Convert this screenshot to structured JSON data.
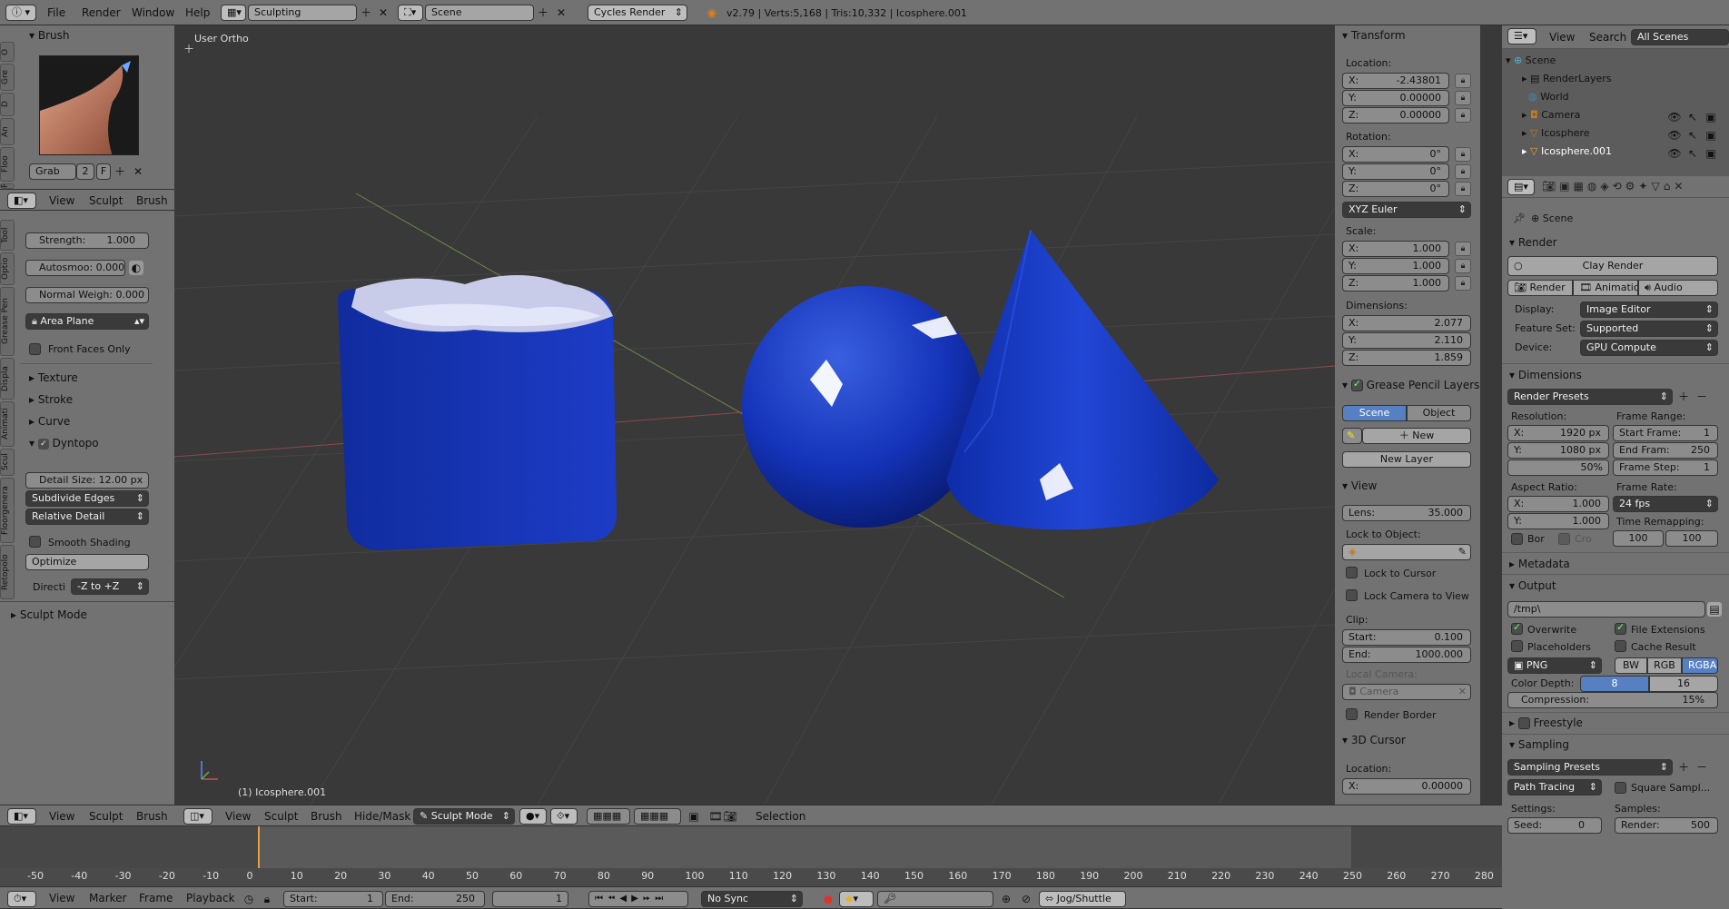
{
  "topbar": {
    "menu": [
      "File",
      "Render",
      "Window",
      "Help"
    ],
    "workspace": "Sculpting",
    "scene": "Scene",
    "engine": "Cycles Render",
    "stats": "v2.79 | Verts:5,168 | Tris:10,332 | Icosphere.001"
  },
  "tool_shelf": {
    "tabs": [
      "O",
      "Gre",
      "D",
      "An",
      "Floo",
      "Re"
    ],
    "brush_title": "Brush",
    "brush_name": "Grab",
    "brush_users": "2",
    "brush_fake": "F",
    "menu": [
      "View",
      "Sculpt",
      "Brush"
    ],
    "tabs2": [
      "Tool",
      "Optio",
      "Grease Pen",
      "Displa",
      "Animati",
      "Scul",
      "Floorgenera",
      "Retopolo"
    ],
    "strength": "Strength:",
    "strength_val": "1.000",
    "autosmooth": "Autosmoo: 0.000",
    "normal_weight": "Normal Weigh: 0.000",
    "area_plane": "Area Plane",
    "front_faces": "Front Faces Only",
    "texture": "Texture",
    "stroke": "Stroke",
    "curve": "Curve",
    "dyntopo": "Dyntopo",
    "detail_size": "Detail Size: 12.00 px",
    "subdivide_edges": "Subdivide Edges",
    "relative_detail": "Relative Detail",
    "smooth_shading": "Smooth Shading",
    "optimize": "Optimize",
    "direction": "Directi",
    "direction_val": "-Z to +Z",
    "sculpt_mode": "Sculpt Mode"
  },
  "viewport": {
    "view_label": "User Ortho",
    "object_label": "(1) Icosphere.001",
    "header": [
      "View",
      "Sculpt",
      "Brush",
      "Hide/Mask"
    ],
    "mode": "Sculpt Mode",
    "selection": "Selection"
  },
  "properties_n": {
    "transform": "Transform",
    "location": "Location:",
    "loc": [
      "X:",
      "-2.43801",
      "Y:",
      "0.00000",
      "Z:",
      "0.00000"
    ],
    "rotation": "Rotation:",
    "rot": [
      "X:",
      "0°",
      "Y:",
      "0°",
      "Z:",
      "0°"
    ],
    "euler": "XYZ Euler",
    "scale": "Scale:",
    "scl": [
      "X:",
      "1.000",
      "Y:",
      "1.000",
      "Z:",
      "1.000"
    ],
    "dimensions": "Dimensions:",
    "dim": [
      "X:",
      "2.077",
      "Y:",
      "2.110",
      "Z:",
      "1.859"
    ],
    "gp_layers": "Grease Pencil Layers",
    "gp_scene": "Scene",
    "gp_object": "Object",
    "gp_new": "New",
    "gp_new_layer": "New Layer",
    "view": "View",
    "lens": "Lens:",
    "lens_val": "35.000",
    "lock_to_object": "Lock to Object:",
    "lock_to_cursor": "Lock to Cursor",
    "lock_cam": "Lock Camera to View",
    "clip": "Clip:",
    "clip_start": "Start:",
    "clip_start_val": "0.100",
    "clip_end": "End:",
    "clip_end_val": "1000.000",
    "local_camera": "Local Camera:",
    "camera": "Camera",
    "render_border": "Render Border",
    "cursor": "3D Cursor",
    "cursor_loc": "Location:",
    "cursor_x": "X:",
    "cursor_x_val": "0.00000"
  },
  "outliner": {
    "menu": [
      "View",
      "Search"
    ],
    "filter": "All Scenes",
    "items": [
      "Scene",
      "RenderLayers",
      "World",
      "Camera",
      "Icosphere",
      "Icosphere.001"
    ]
  },
  "render_props": {
    "scene": "Scene",
    "render": "Render",
    "clay": "Clay Render",
    "tabs": [
      "Render",
      "Animation",
      "Audio"
    ],
    "display": "Display:",
    "display_val": "Image Editor",
    "feature_set": "Feature Set:",
    "feature_val": "Supported",
    "device": "Device:",
    "device_val": "GPU Compute",
    "dimensions": "Dimensions",
    "presets": "Render Presets",
    "resolution": "Resolution:",
    "res_x": "X:",
    "res_x_val": "1920 px",
    "res_y": "Y:",
    "res_y_val": "1080 px",
    "res_pct": "50%",
    "frame_range": "Frame Range:",
    "start_frame": "Start Frame:",
    "start_frame_val": "1",
    "end_frame": "End Fram:",
    "end_frame_val": "250",
    "frame_step": "Frame Step:",
    "frame_step_val": "1",
    "aspect": "Aspect Ratio:",
    "asp_x": "X:",
    "asp_x_val": "1.000",
    "asp_y": "Y:",
    "asp_y_val": "1.000",
    "frame_rate": "Frame Rate:",
    "fps": "24 fps",
    "time_remap": "Time Remapping:",
    "remap_a": "100",
    "remap_b": "100",
    "border": "Bor",
    "crop": "Cro",
    "metadata": "Metadata",
    "output": "Output",
    "path": "/tmp\\",
    "overwrite": "Overwrite",
    "file_ext": "File Extensions",
    "placeholders": "Placeholders",
    "cache": "Cache Result",
    "format": "PNG",
    "bw": "BW",
    "rgb": "RGB",
    "rgba": "RGBA",
    "color_depth": "Color Depth:",
    "depth8": "8",
    "depth16": "16",
    "compression": "Compression:",
    "compression_val": "15%",
    "freestyle": "Freestyle",
    "sampling": "Sampling",
    "sampling_presets": "Sampling Presets",
    "path_tracing": "Path Tracing",
    "square": "Square Sampl...",
    "settings": "Settings:",
    "samples": "Samples:",
    "seed": "Seed:",
    "seed_val": "0",
    "render_samples": "Render:",
    "render_samples_val": "500"
  },
  "timeline": {
    "ticks": [
      "-50",
      "-40",
      "-30",
      "-20",
      "-10",
      "0",
      "10",
      "20",
      "30",
      "40",
      "50",
      "60",
      "70",
      "80",
      "90",
      "100",
      "110",
      "120",
      "130",
      "140",
      "150",
      "160",
      "170",
      "180",
      "190",
      "200",
      "210",
      "220",
      "230",
      "240",
      "250",
      "260",
      "270",
      "280"
    ],
    "menu": [
      "View",
      "Marker",
      "Frame",
      "Playback"
    ],
    "start": "Start:",
    "start_val": "1",
    "end": "End:",
    "end_val": "250",
    "current": "1",
    "sync": "No Sync",
    "keying": "Jog/Shuttle"
  }
}
